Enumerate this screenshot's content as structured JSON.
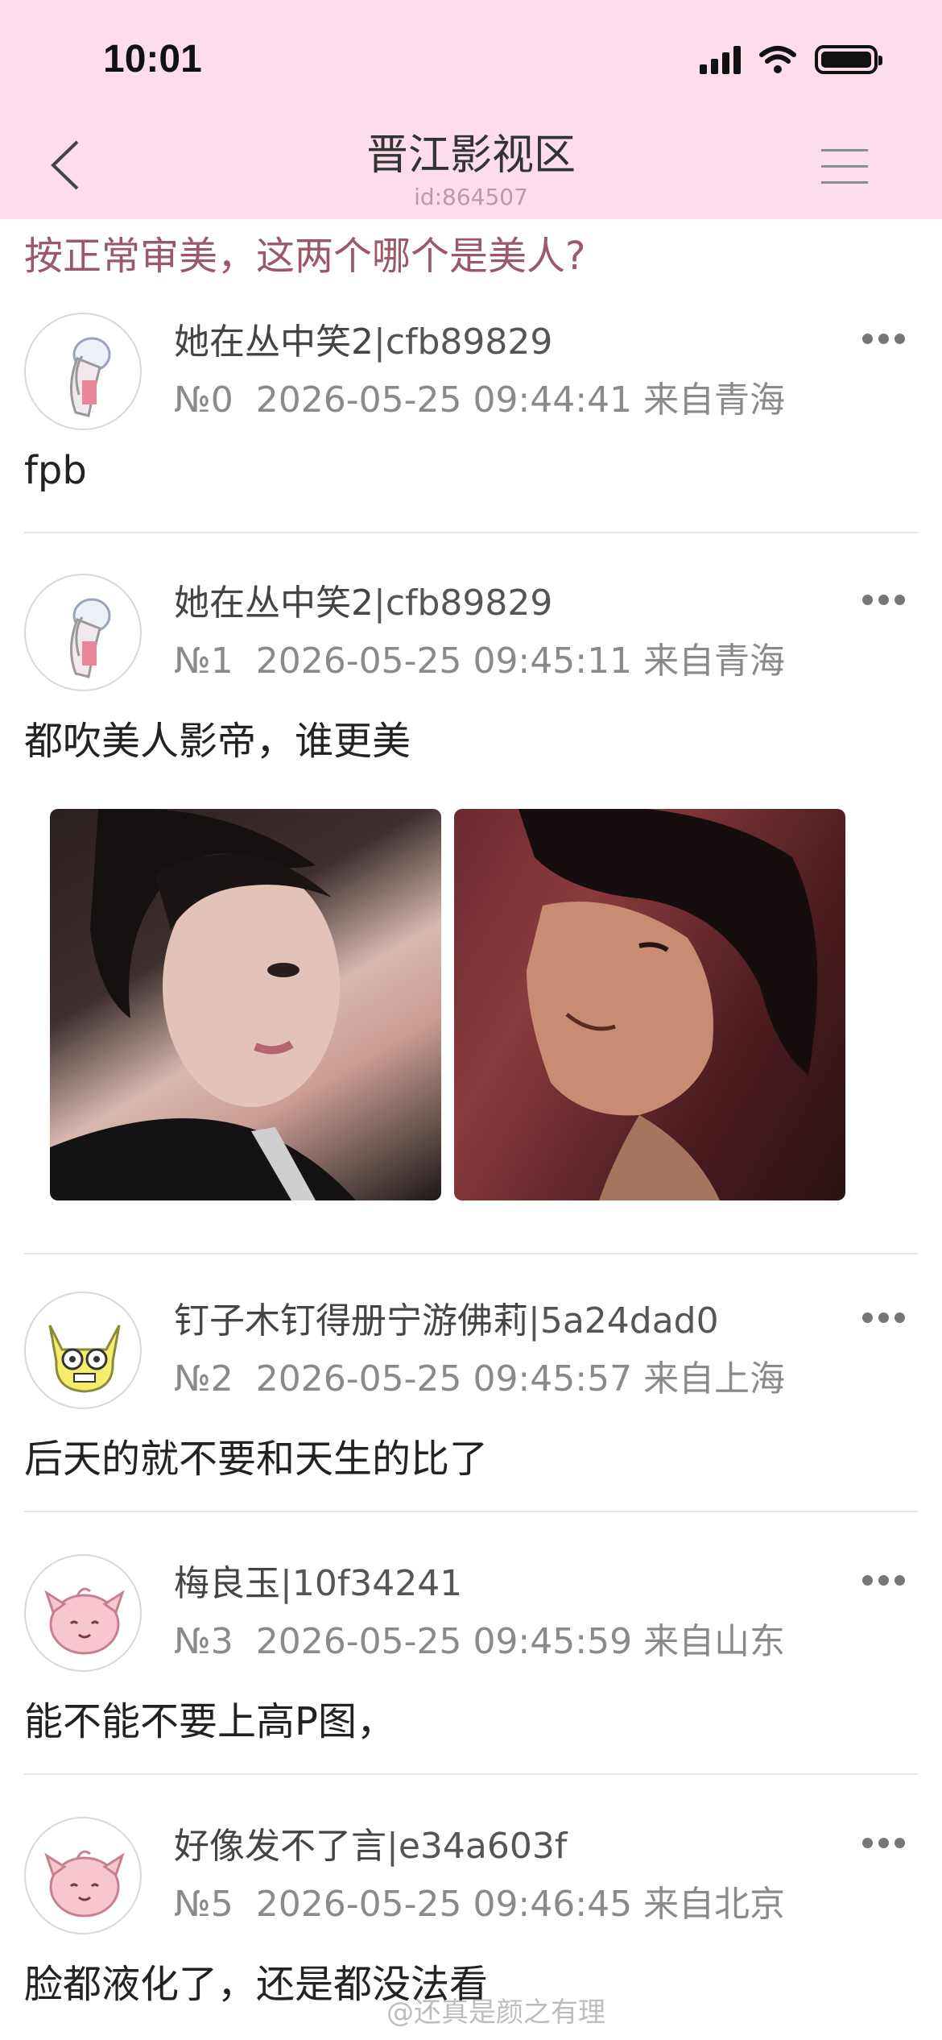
{
  "status": {
    "time": "10:01"
  },
  "nav": {
    "title": "晋江影视区",
    "id": "id:864507"
  },
  "thread_title": "按正常审美，这两个哪个是美人?",
  "posts": [
    {
      "name": "她在丛中笑2",
      "uid": "|cfb89829",
      "floor": "№0",
      "datetime": "2026-05-25 09:44:41",
      "location": "来自青海",
      "content": "fpb"
    },
    {
      "name": "她在丛中笑2",
      "uid": "|cfb89829",
      "floor": "№1",
      "datetime": "2026-05-25 09:45:11",
      "location": "来自青海",
      "content": "都吹美人影帝，谁更美"
    },
    {
      "name": "钉子木钉得册宁游佛莉",
      "uid": "|5a24dad0",
      "floor": "№2",
      "datetime": "2026-05-25 09:45:57",
      "location": "来自上海",
      "content": "后天的就不要和天生的比了"
    },
    {
      "name": "梅良玉",
      "uid": "|10f34241",
      "floor": "№3",
      "datetime": "2026-05-25 09:45:59",
      "location": "来自山东",
      "content": "能不能不要上高P图，"
    },
    {
      "name": "好像发不了言",
      "uid": "|e34a603f",
      "floor": "№5",
      "datetime": "2026-05-25 09:46:45",
      "location": "来自北京",
      "content": "脸都液化了，还是都没法看"
    }
  ],
  "watermark": "@还真是颜之有理",
  "colors": {
    "header_bg": "#fddcec",
    "title_color": "#9a5869"
  }
}
